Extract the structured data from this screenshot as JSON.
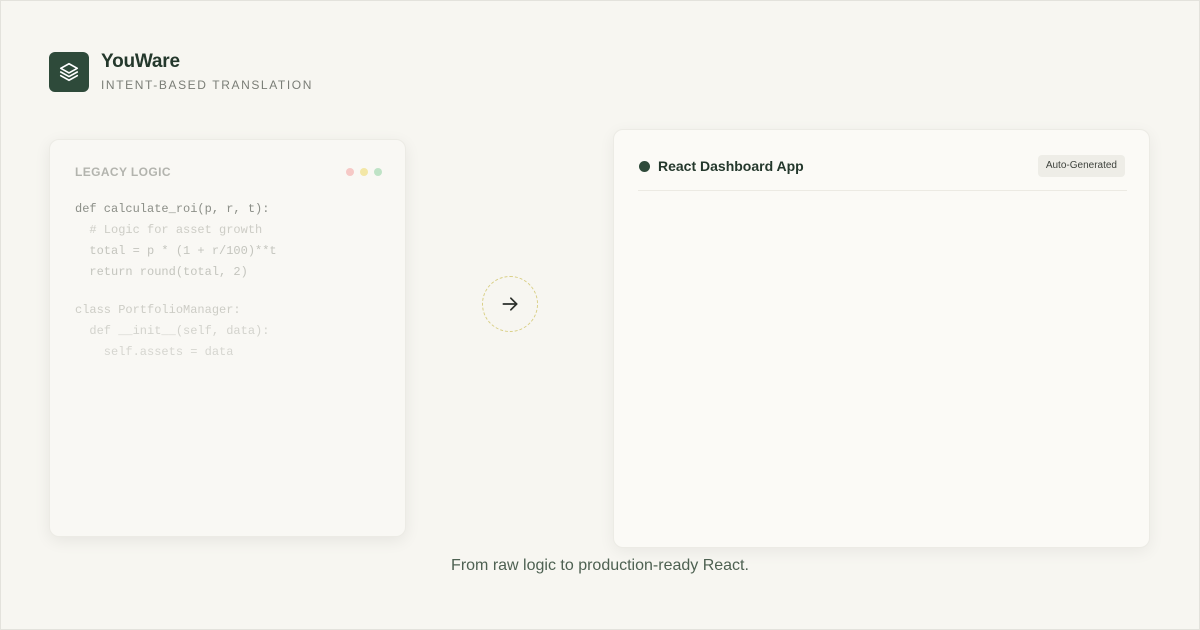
{
  "brand": {
    "name": "YouWare",
    "tagline": "INTENT-BASED TRANSLATION",
    "logo_icon": "layers-icon",
    "color": "#2e4a3a"
  },
  "legacy_card": {
    "title": "LEGACY LOGIC",
    "window_dots": [
      "#f6c9c6",
      "#f3e7a6",
      "#bfe3c6"
    ],
    "code_lines": [
      "def calculate_roi(p, r, t):",
      "  # Logic for asset growth",
      "  total = p * (1 + r/100)**t",
      "  return round(total, 2)",
      "",
      "class PortfolioManager:",
      "  def __init__(self, data):",
      "    self.assets = data"
    ]
  },
  "arrow": {
    "icon": "arrow-right-icon"
  },
  "react_card": {
    "title": "React Dashboard App",
    "badge": "Auto-Generated"
  },
  "caption": "From raw logic to production-ready React."
}
